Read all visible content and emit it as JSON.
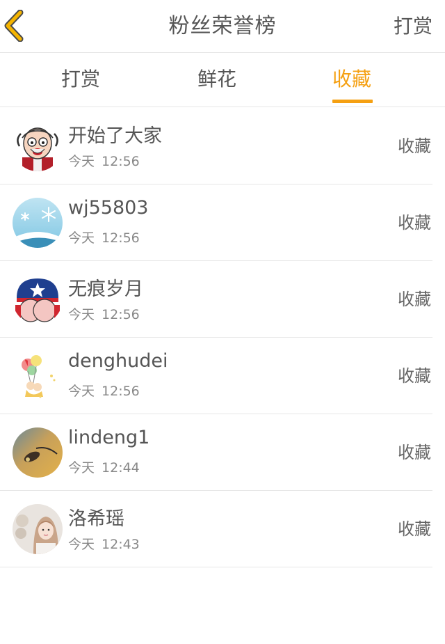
{
  "header": {
    "title": "粉丝荣誉榜",
    "action_label": "打赏",
    "back_icon": "chevron-left-icon",
    "back_color": "#f5b400"
  },
  "tabs": [
    {
      "label": "打赏",
      "active": false
    },
    {
      "label": "鲜花",
      "active": false
    },
    {
      "label": "收藏",
      "active": true
    }
  ],
  "accent_color": "#f5a012",
  "fans": [
    {
      "name": "开始了大家",
      "day": "今天",
      "time": "12:56",
      "action": "收藏",
      "avatar": "cartoon-old-man-avatar"
    },
    {
      "name": "wj55803",
      "day": "今天",
      "time": "12:56",
      "action": "收藏",
      "avatar": "snowflake-avatar"
    },
    {
      "name": "无痕岁月",
      "day": "今天",
      "time": "12:56",
      "action": "收藏",
      "avatar": "captain-shield-cartoon-avatar"
    },
    {
      "name": "denghudei",
      "day": "今天",
      "time": "12:56",
      "action": "收藏",
      "avatar": "balloon-couple-avatar"
    },
    {
      "name": "lindeng1",
      "day": "今天",
      "time": "12:44",
      "action": "收藏",
      "avatar": "blurred-photo-avatar"
    },
    {
      "name": "洛希瑶",
      "day": "今天",
      "time": "12:43",
      "action": "收藏",
      "avatar": "girl-photo-avatar"
    }
  ]
}
